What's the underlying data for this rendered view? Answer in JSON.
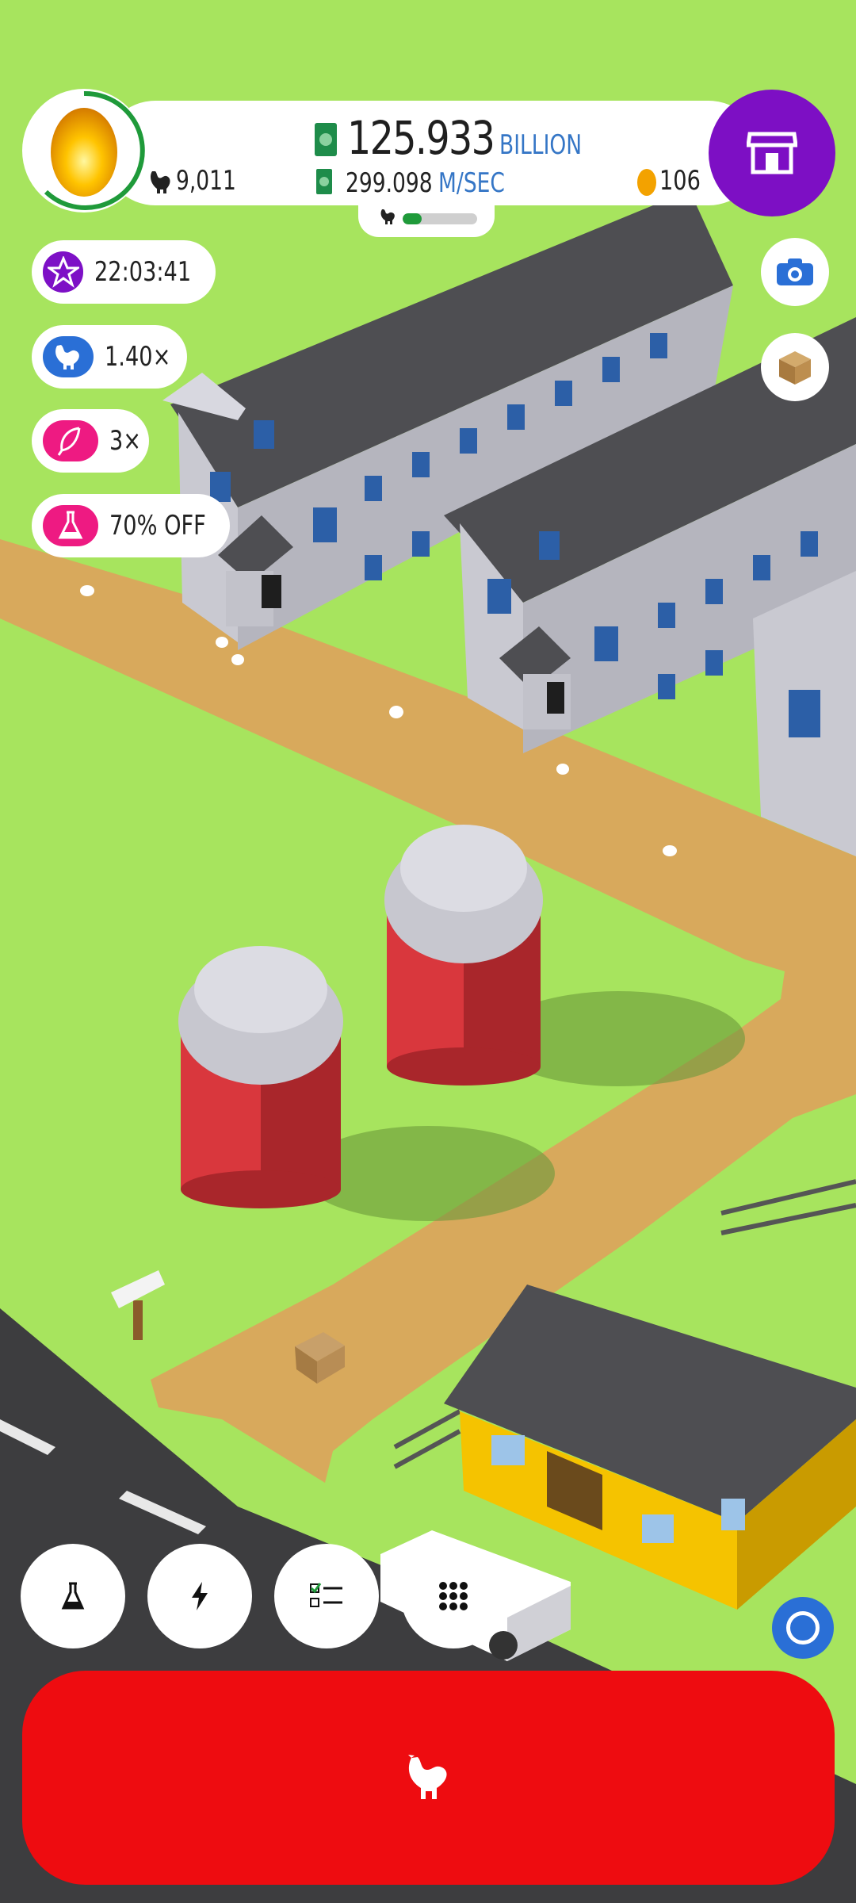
{
  "hud": {
    "money_value": "125.933",
    "money_unit": "BILLION",
    "chicken_count": "9,011",
    "rate_value": "299.098",
    "rate_unit": "M/SEC",
    "golden_eggs": "106",
    "hab_fill_fraction": 0.25
  },
  "boosts": [
    {
      "icon": "star-icon",
      "label": "22:03:41",
      "color": "#7d10c6"
    },
    {
      "icon": "chicken-icon",
      "label": "1.40×",
      "color": "#2a6fd6"
    },
    {
      "icon": "feather-icon",
      "label": "3×",
      "color": "#ee1a82"
    },
    {
      "icon": "flask-icon",
      "label": "70% OFF",
      "color": "#ee1a82"
    }
  ],
  "side_buttons": [
    "camera-icon",
    "box-icon"
  ],
  "toolbar": [
    "flask-icon",
    "lightning-icon",
    "checklist-icon",
    "grid-icon"
  ],
  "colors": {
    "grass": "#a7e45e",
    "shop": "#7d0fc4",
    "hatch_button": "#ee0c10",
    "accent_blue": "#3576c6"
  }
}
